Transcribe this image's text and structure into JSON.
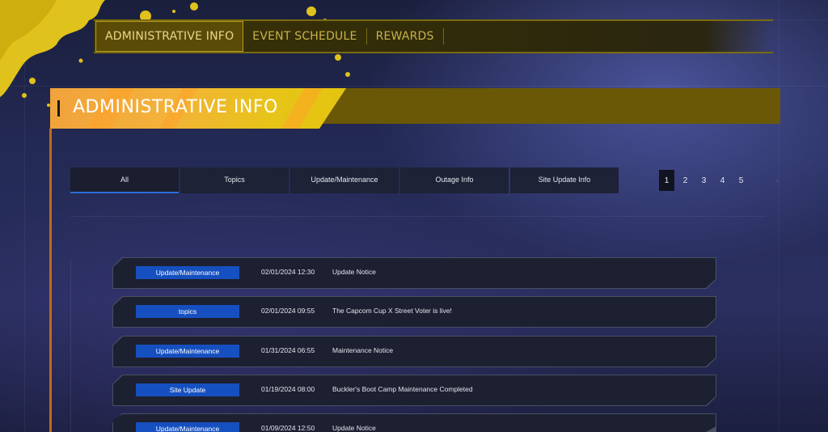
{
  "nav": {
    "tabs": [
      {
        "label": "ADMINISTRATIVE INFO",
        "active": true
      },
      {
        "label": "EVENT SCHEDULE",
        "active": false
      },
      {
        "label": "REWARDS",
        "active": false
      }
    ]
  },
  "section": {
    "title": "ADMINISTRATIVE INFO"
  },
  "filters": {
    "tabs": [
      {
        "label": "All",
        "active": true
      },
      {
        "label": "Topics",
        "active": false
      },
      {
        "label": "Update/Maintenance",
        "active": false
      },
      {
        "label": "Outage Info",
        "active": false
      },
      {
        "label": "Site Update Info",
        "active": false
      }
    ]
  },
  "pagination": {
    "pages": [
      "1",
      "2",
      "3",
      "4",
      "5"
    ],
    "current": "1",
    "next_icon": "chevron-right-icon",
    "next_glyph": "›"
  },
  "news": [
    {
      "category": "Update/Maintenance",
      "date": "02/01/2024 12:30",
      "title": "Update Notice"
    },
    {
      "category": "topics",
      "date": "02/01/2024 09:55",
      "title": "The Capcom Cup X Street Voter is live!"
    },
    {
      "category": "Update/Maintenance",
      "date": "01/31/2024 06:55",
      "title": "Maintenance Notice"
    },
    {
      "category": "Site Update",
      "date": "01/19/2024 08:00",
      "title": "Buckler's Boot Camp Maintenance Completed"
    },
    {
      "category": "Update/Maintenance",
      "date": "01/09/2024 12:50",
      "title": "Update Notice"
    }
  ],
  "colors": {
    "accent_yellow": "#e4c40f",
    "accent_orange": "#f1a23c",
    "badge_blue": "#1650c0",
    "active_underline": "#2b6fd6"
  }
}
